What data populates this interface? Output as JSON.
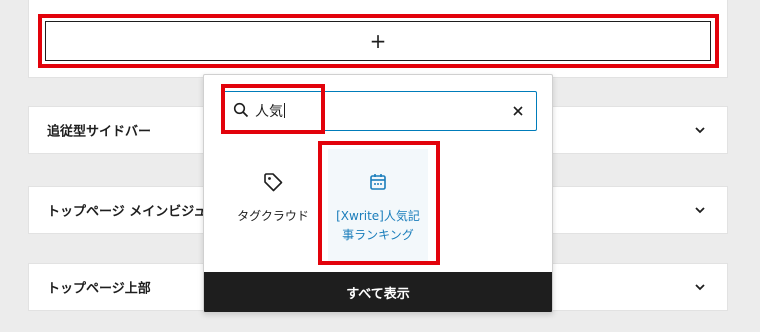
{
  "inserter_button": {
    "icon": "plus-icon",
    "label": "+"
  },
  "panels": [
    {
      "label": "追従型サイドバー",
      "icon": "chevron-down-icon"
    },
    {
      "label": "トップページ メインビジュアル",
      "icon": "chevron-down-icon"
    },
    {
      "label": "トップページ上部",
      "icon": "chevron-down-icon"
    }
  ],
  "inserter": {
    "search": {
      "value": "人気",
      "search_icon": "search-icon",
      "clear_icon": "close-icon"
    },
    "results": [
      {
        "label": "タグクラウド",
        "icon": "tag-icon"
      },
      {
        "label": "[Xwrite]人気記事ランキング",
        "line1": "[Xwrite]人気記",
        "line2": "事ランキング",
        "icon": "calendar-icon"
      }
    ],
    "show_all_label": "すべて表示"
  },
  "colors": {
    "highlight": "#e2020b",
    "accent": "#007cba",
    "dark": "#1e1e1e"
  }
}
